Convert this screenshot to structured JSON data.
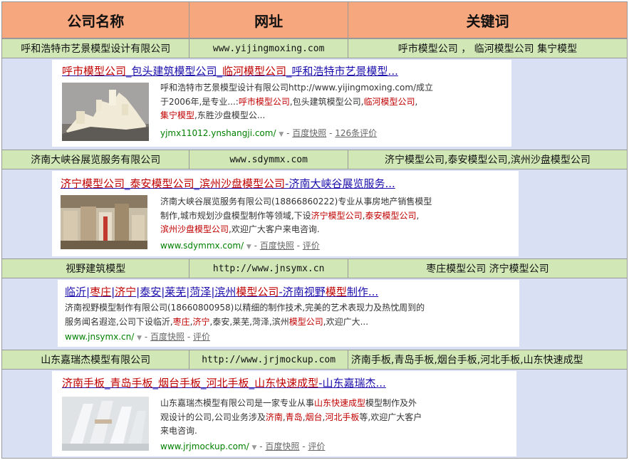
{
  "header": {
    "col1": "公司名称",
    "col2": "网址",
    "col3": "关键词"
  },
  "companies": [
    {
      "name": "呼和浩特市艺景模型设计有限公司",
      "site": "www.yijingmoxing.com",
      "keywords": "呼市模型公司 ， 临河模型公司  集宁模型",
      "result": {
        "title_parts": [
          {
            "t": "呼市模型公司",
            "hl": true
          },
          {
            "t": "_包头建筑模型公司_",
            "hl": false
          },
          {
            "t": "临河模型公司",
            "hl": true
          },
          {
            "t": "_呼和浩特市艺景模型...",
            "hl": false
          }
        ],
        "desc_lines": [
          [
            {
              "t": "呼和浩特市艺景模型设计有限公司http://www.yijingmoxing.com/成立",
              "hl": false
            }
          ],
          [
            {
              "t": "于2006年,是专业...:",
              "hl": false
            },
            {
              "t": "呼市模型公司",
              "hl": true
            },
            {
              "t": ",包头建筑模型公司,",
              "hl": false
            },
            {
              "t": "临河模型公司",
              "hl": true
            },
            {
              "t": ",",
              "hl": false
            }
          ],
          [
            {
              "t": "集宁模型",
              "hl": true
            },
            {
              "t": ",东胜沙盘模型公...",
              "hl": false
            }
          ]
        ],
        "url": "yjmx11012.ynshangji.com/",
        "snapshot": "百度快照",
        "extra": "126条评价"
      }
    },
    {
      "name": "济南大峡谷展览服务有限公司",
      "site": "www.sdymmx.com",
      "keywords": "济宁模型公司,泰安模型公司,滨州沙盘模型公司",
      "result": {
        "title_parts": [
          {
            "t": "济宁模型公司",
            "hl": true
          },
          {
            "t": "_",
            "hl": false
          },
          {
            "t": "泰安模型公司",
            "hl": true
          },
          {
            "t": "_",
            "hl": false
          },
          {
            "t": "滨州沙盘模型公司",
            "hl": true
          },
          {
            "t": "-济南大峡谷展览服务...",
            "hl": false
          }
        ],
        "desc_lines": [
          [
            {
              "t": "济南大峡谷展览服务有限公司(18866860222)专业从事房地产销售模型",
              "hl": false
            }
          ],
          [
            {
              "t": "制作,城市规划沙盘模型制作等领域,下设",
              "hl": false
            },
            {
              "t": "济宁模型公司",
              "hl": true
            },
            {
              "t": ",",
              "hl": false
            },
            {
              "t": "泰安模型公司",
              "hl": true
            },
            {
              "t": ",",
              "hl": false
            }
          ],
          [
            {
              "t": "滨州沙盘模型公司",
              "hl": true
            },
            {
              "t": ",欢迎广大客户来电咨询.",
              "hl": false
            }
          ]
        ],
        "url": "www.sdymmx.com/",
        "snapshot": "百度快照",
        "extra": "评价"
      }
    },
    {
      "name": "视野建筑模型",
      "site": "http://www.jnsymx.cn",
      "keywords": "枣庄模型公司     济宁模型公司",
      "result": {
        "title_parts": [
          {
            "t": "临沂|",
            "hl": false
          },
          {
            "t": "枣庄",
            "hl": true
          },
          {
            "t": "|",
            "hl": false
          },
          {
            "t": "济宁",
            "hl": true
          },
          {
            "t": "|泰安|莱芜|菏泽|滨州",
            "hl": false
          },
          {
            "t": "模型公司",
            "hl": true
          },
          {
            "t": "-济南视野",
            "hl": false
          },
          {
            "t": "模型",
            "hl": true
          },
          {
            "t": "制作...",
            "hl": false
          }
        ],
        "desc_lines": [
          [
            {
              "t": "济南视野模型制作有限公司(18660800958)以精细的制作技术,完美的艺术表现力及热忱周到的",
              "hl": false
            }
          ],
          [
            {
              "t": "服务闻名遐迩,公司下设临沂,",
              "hl": false
            },
            {
              "t": "枣庄",
              "hl": true
            },
            {
              "t": ",",
              "hl": false
            },
            {
              "t": "济宁",
              "hl": true
            },
            {
              "t": ",泰安,莱芜,菏泽,滨州",
              "hl": false
            },
            {
              "t": "模型公司",
              "hl": true
            },
            {
              "t": ",欢迎广大...",
              "hl": false
            }
          ]
        ],
        "url": "www.jnsymx.cn/",
        "snapshot": "百度快照",
        "extra": "评价"
      }
    },
    {
      "name": "山东嘉瑞杰模型有限公司",
      "site": "http://www.jrjmockup.com",
      "keywords": "济南手板,青岛手板,烟台手板,河北手板,山东快速成型",
      "result": {
        "title_parts": [
          {
            "t": "济南手板",
            "hl": true
          },
          {
            "t": "_",
            "hl": false
          },
          {
            "t": "青岛手板",
            "hl": true
          },
          {
            "t": "_",
            "hl": false
          },
          {
            "t": "烟台手板",
            "hl": true
          },
          {
            "t": "_",
            "hl": false
          },
          {
            "t": "河北手板",
            "hl": true
          },
          {
            "t": "_",
            "hl": false
          },
          {
            "t": "山东快速成型",
            "hl": true
          },
          {
            "t": "-山东嘉瑞杰...",
            "hl": false
          }
        ],
        "desc_lines": [
          [
            {
              "t": "山东嘉瑞杰模型有限公司是一家专业从事",
              "hl": false
            },
            {
              "t": "山东快速成型",
              "hl": true
            },
            {
              "t": "模型制作及外",
              "hl": false
            }
          ],
          [
            {
              "t": "观设计的公司,公司业务涉及",
              "hl": false
            },
            {
              "t": "济南",
              "hl": true
            },
            {
              "t": ",",
              "hl": false
            },
            {
              "t": "青岛",
              "hl": true
            },
            {
              "t": ",",
              "hl": false
            },
            {
              "t": "烟台",
              "hl": true
            },
            {
              "t": ",",
              "hl": false
            },
            {
              "t": "河北手板",
              "hl": true
            },
            {
              "t": "等,欢迎广大客户",
              "hl": false
            }
          ],
          [
            {
              "t": "来电咨询.",
              "hl": false
            }
          ]
        ],
        "url": "www.jrjmockup.com/",
        "snapshot": "百度快照",
        "extra": "评价"
      }
    }
  ]
}
